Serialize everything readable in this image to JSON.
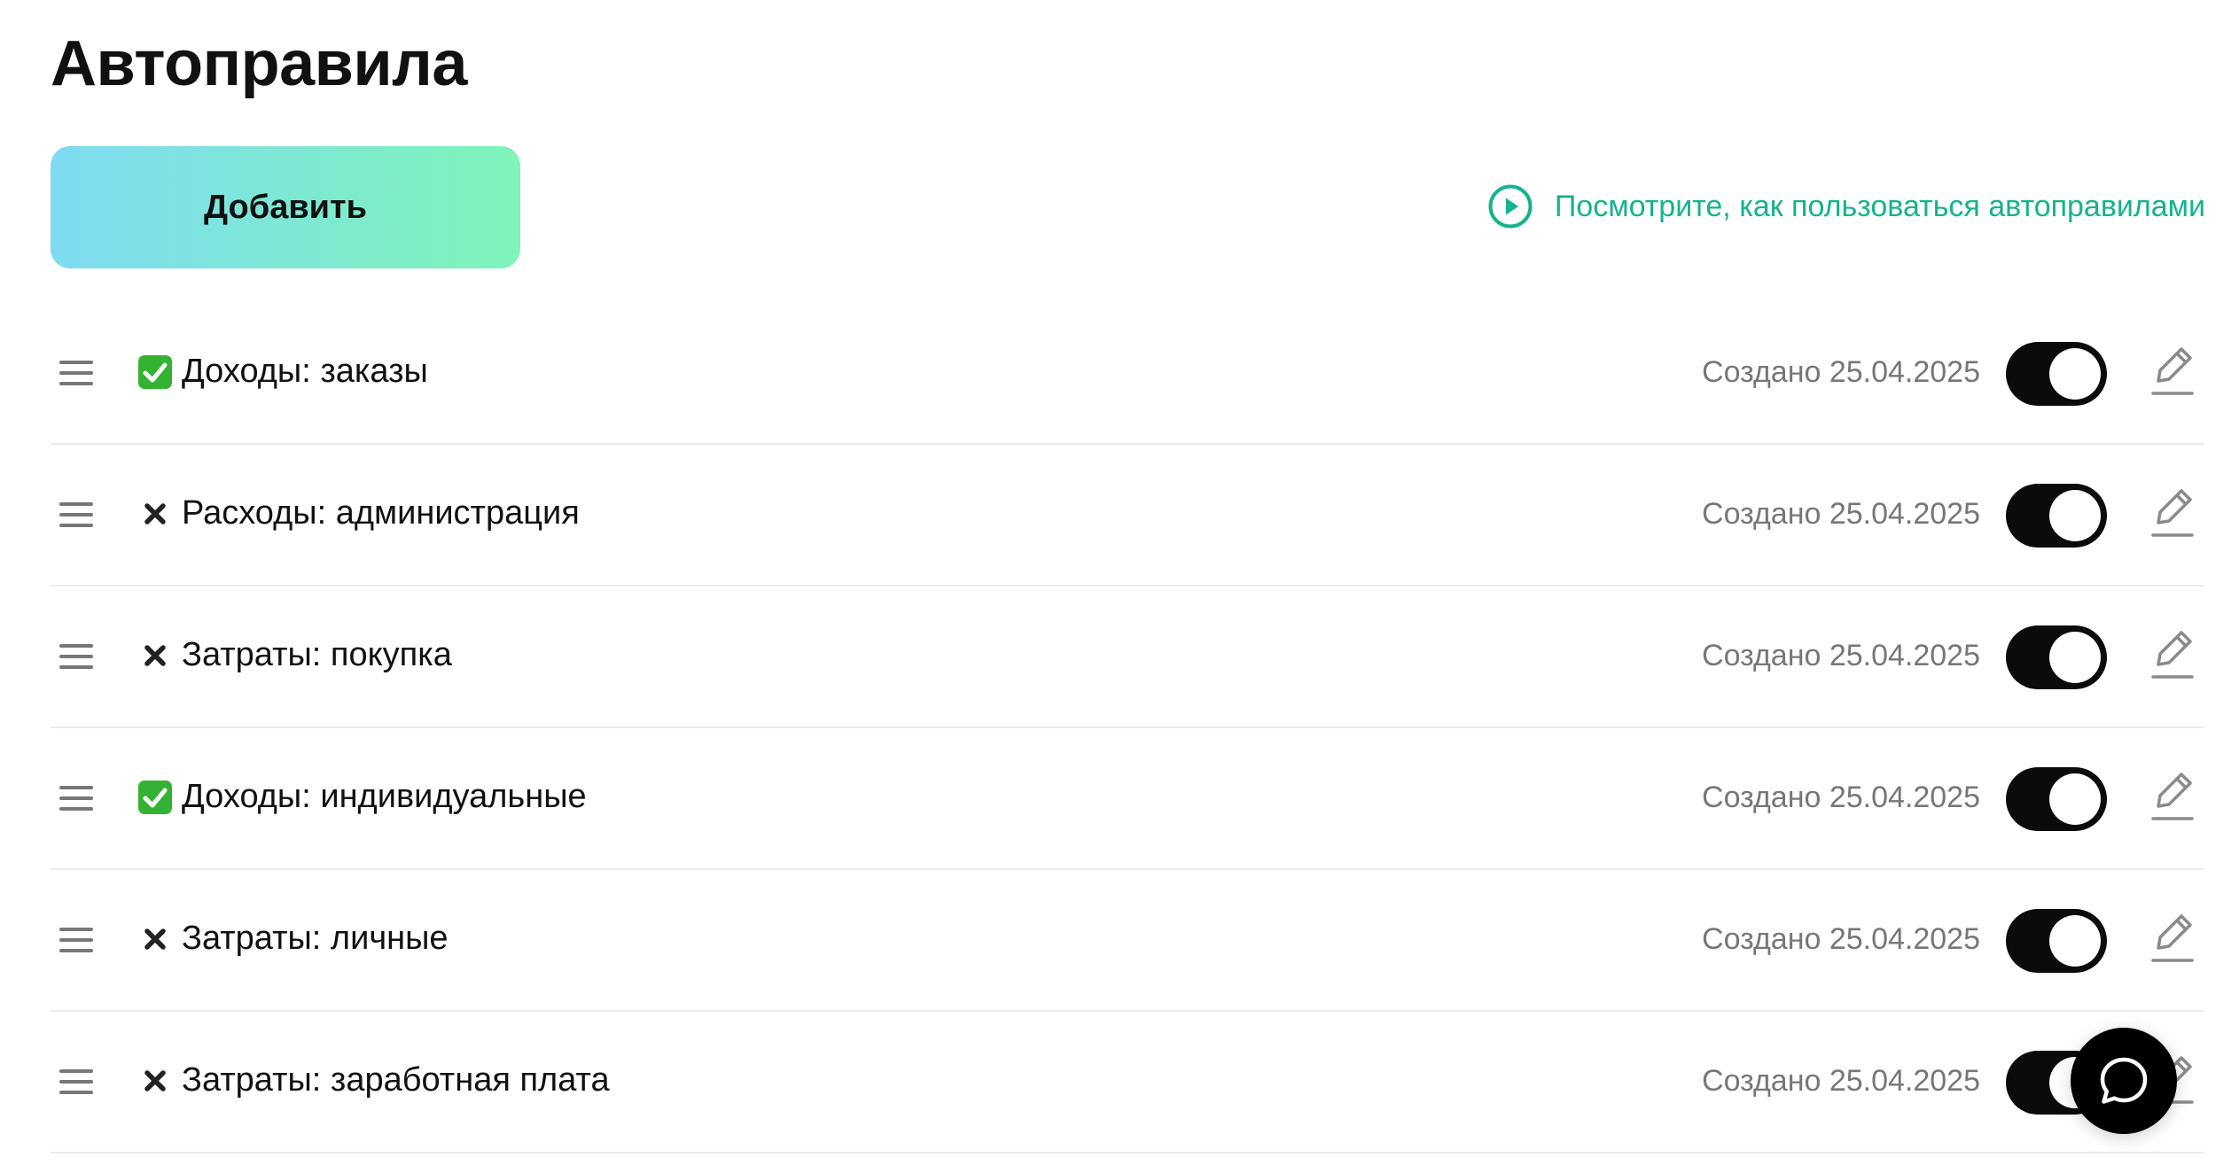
{
  "header": {
    "title": "Автоправила"
  },
  "toolbar": {
    "add_label": "Добавить",
    "help_link_text": "Посмотрите, как пользоваться автоправилами",
    "help_icon": "play-circle-icon"
  },
  "colors": {
    "accent_green": "#14b38e",
    "button_gradient_start": "#7fdbf2",
    "button_gradient_end": "#7ef4b8",
    "toggle_on": "#0b0b0b",
    "muted_text": "#777777"
  },
  "rules": [
    {
      "status": "check",
      "name": "Доходы: заказы",
      "created": "Создано 25.04.2025",
      "enabled": true
    },
    {
      "status": "cross",
      "name": "Расходы: администрация",
      "created": "Создано 25.04.2025",
      "enabled": true
    },
    {
      "status": "cross",
      "name": "Затраты: покупка",
      "created": "Создано 25.04.2025",
      "enabled": true
    },
    {
      "status": "check",
      "name": "Доходы: индивидуальные",
      "created": "Создано 25.04.2025",
      "enabled": true
    },
    {
      "status": "cross",
      "name": "Затраты: личные",
      "created": "Создано 25.04.2025",
      "enabled": true
    },
    {
      "status": "cross",
      "name": "Затраты: заработная плата",
      "created": "Создано 25.04.2025",
      "enabled": true
    }
  ],
  "chat": {
    "icon": "chat-bubble-icon"
  }
}
